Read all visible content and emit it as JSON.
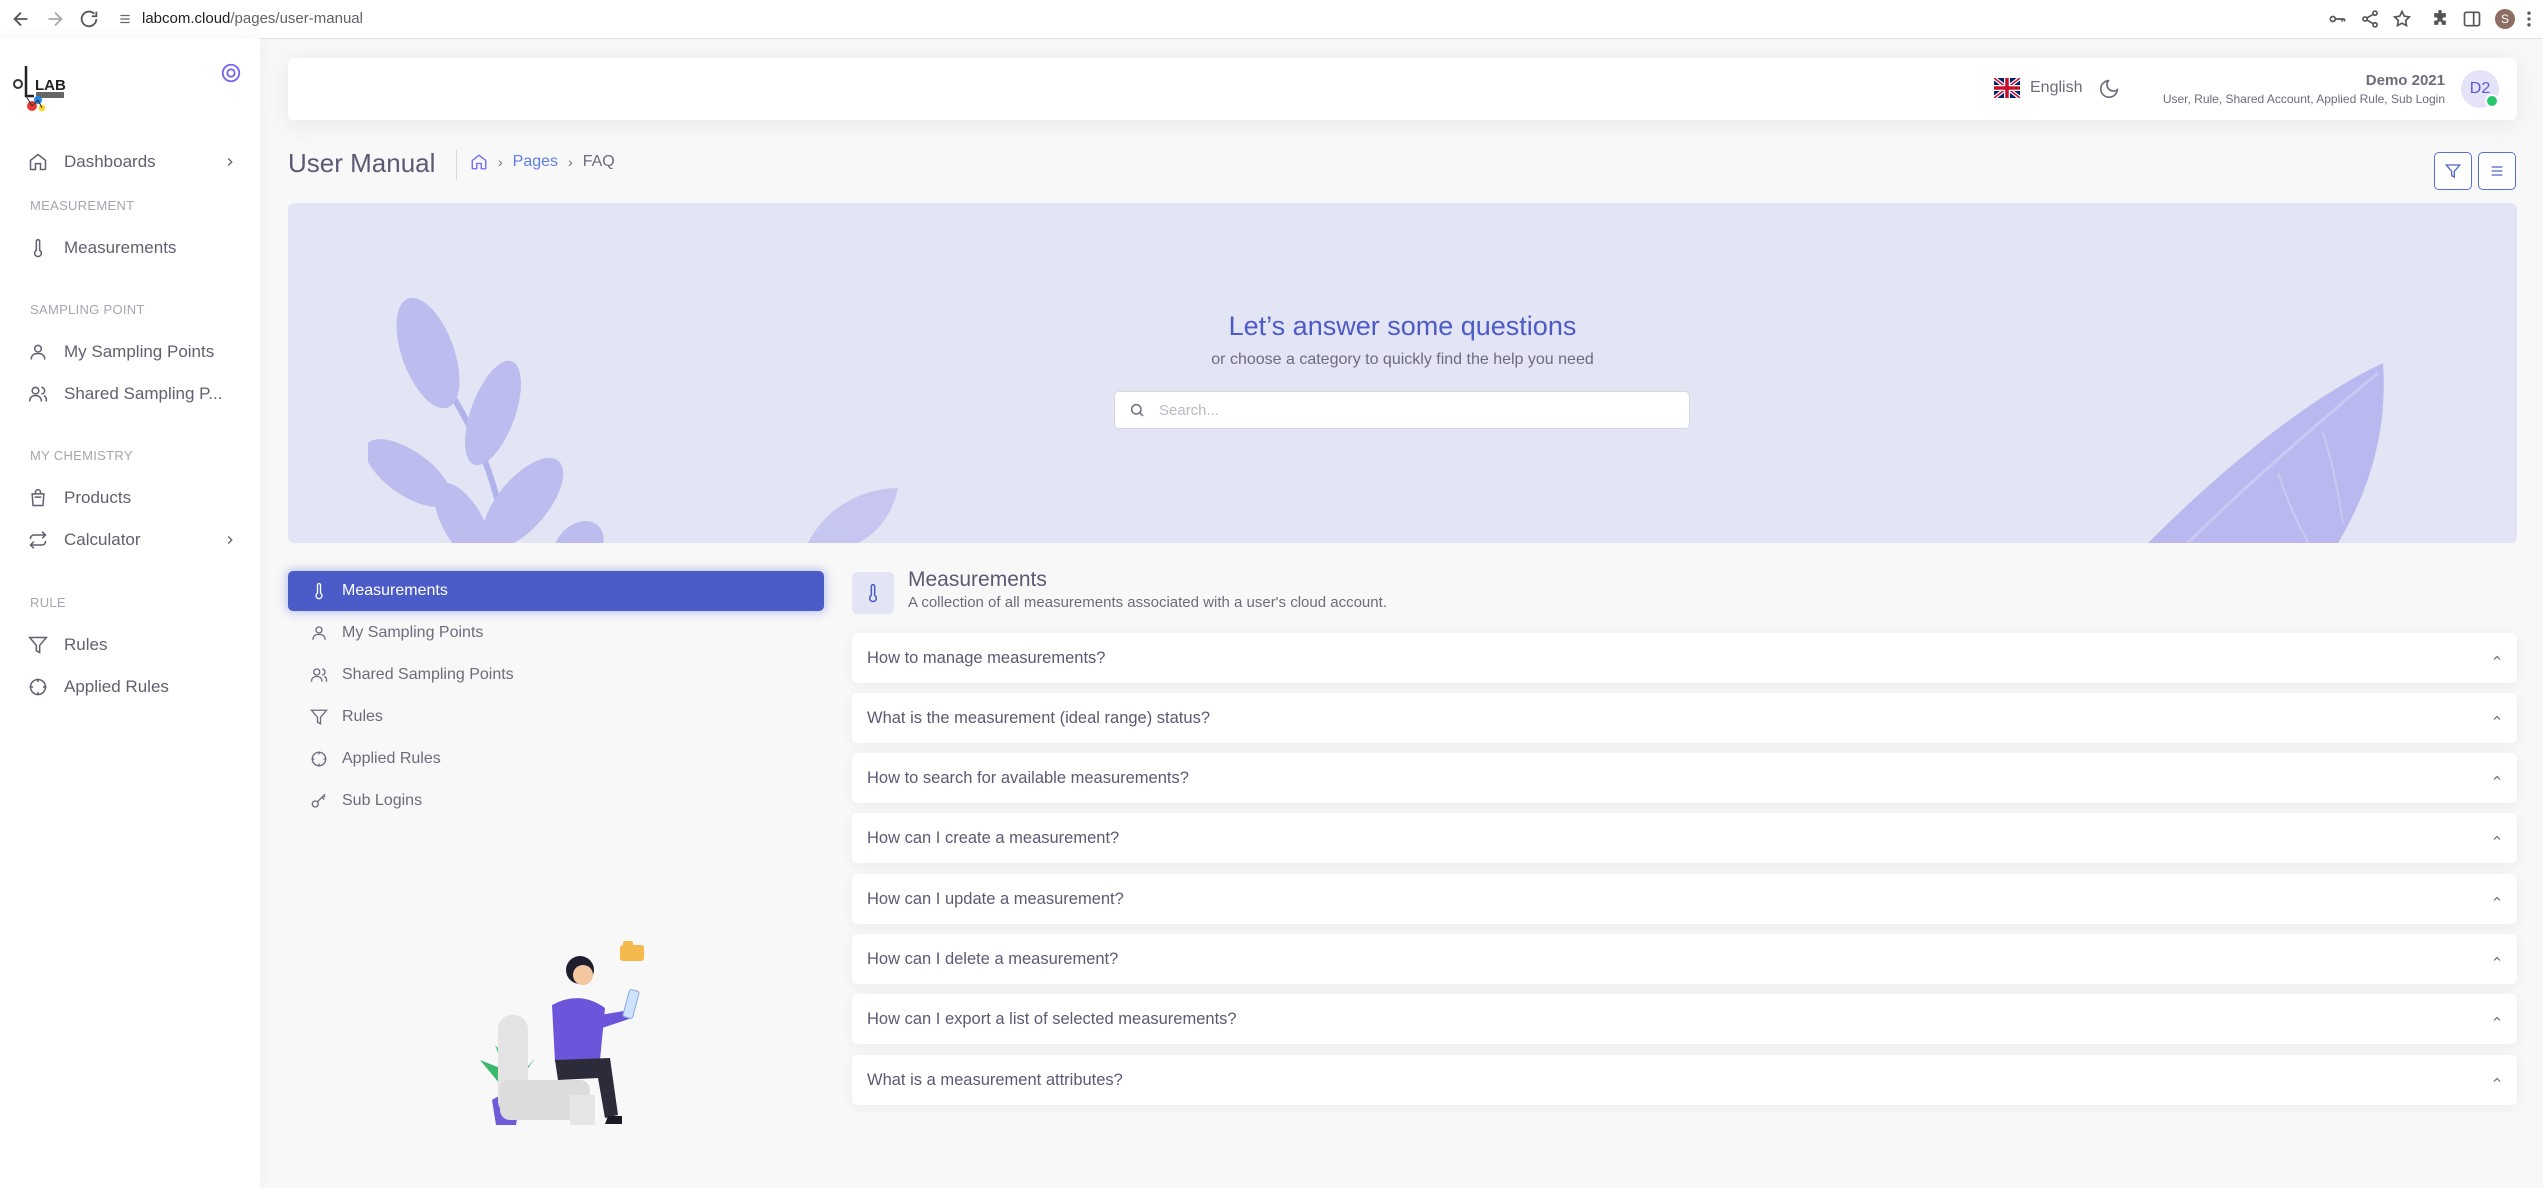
{
  "browser": {
    "url_host": "labcom.cloud",
    "url_path": "/pages/user-manual"
  },
  "sidebar": {
    "logo_text": "LAB",
    "items": [
      {
        "label": "Dashboards",
        "icon": "home-icon",
        "has_arrow": true
      },
      {
        "label": "Measurements",
        "icon": "thermometer-icon"
      },
      {
        "label": "My Sampling Points",
        "icon": "user-icon"
      },
      {
        "label": "Shared Sampling P...",
        "icon": "users-icon"
      },
      {
        "label": "Products",
        "icon": "shopping-bag-icon"
      },
      {
        "label": "Calculator",
        "icon": "repeat-icon",
        "has_arrow": true
      },
      {
        "label": "Rules",
        "icon": "filter-icon"
      },
      {
        "label": "Applied Rules",
        "icon": "crosshair-icon"
      }
    ],
    "sections": [
      "MEASUREMENT",
      "SAMPLING POINT",
      "MY CHEMISTRY",
      "RULE"
    ]
  },
  "header": {
    "language": "English",
    "user_name": "Demo 2021",
    "user_roles": "User, Rule, Shared Account, Applied Rule, Sub Login",
    "avatar_initials": "D2",
    "status_color": "#28c76f"
  },
  "page": {
    "title": "User Manual",
    "breadcrumb": [
      "Pages",
      "FAQ"
    ]
  },
  "hero": {
    "title": "Let’s answer some questions",
    "subtitle": "or choose a category to quickly find the help you need",
    "search_placeholder": "Search..."
  },
  "categories": [
    {
      "label": "Measurements",
      "icon": "thermometer-icon",
      "active": true
    },
    {
      "label": "My Sampling Points",
      "icon": "user-icon"
    },
    {
      "label": "Shared Sampling Points",
      "icon": "users-icon"
    },
    {
      "label": "Rules",
      "icon": "filter-icon"
    },
    {
      "label": "Applied Rules",
      "icon": "crosshair-icon"
    },
    {
      "label": "Sub Logins",
      "icon": "key-icon"
    }
  ],
  "faq": {
    "title": "Measurements",
    "subtitle": "A collection of all measurements associated with a user's cloud account.",
    "questions": [
      "How to manage measurements?",
      "What is the measurement (ideal range) status?",
      "How to search for available measurements?",
      "How can I create a measurement?",
      "How can I update a measurement?",
      "How can I delete a measurement?",
      "How can I export a list of selected measurements?",
      "What is a measurement attributes?"
    ]
  },
  "colors": {
    "accent": "#4b5bc8",
    "hero_bg": "#e3e5f4"
  }
}
